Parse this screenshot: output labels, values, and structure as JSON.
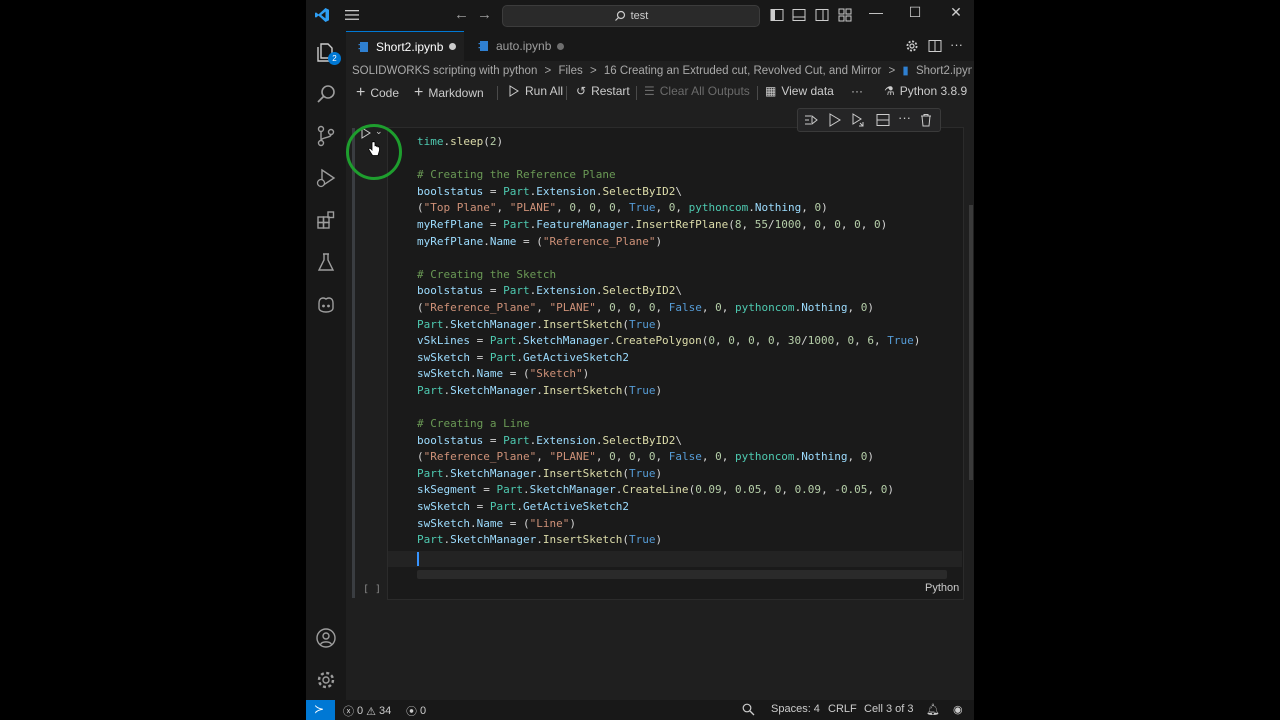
{
  "titlebar": {
    "search_text": "test"
  },
  "activity_badges": {
    "explorer": "2"
  },
  "tabs": [
    {
      "label": "Short2.ipynb",
      "active": true,
      "dirty": true
    },
    {
      "label": "auto.ipynb",
      "active": false,
      "dirty": true
    }
  ],
  "breadcrumb": {
    "part1": "SOLIDWORKS scripting with python",
    "sep1": ">",
    "part2": "Files",
    "sep2": ">",
    "part3": "16 Creating an Extruded cut, Revolved Cut, and Mirror",
    "sep3": ">",
    "part4": "Short2.ipynb",
    "sep4": ">"
  },
  "notebook_toolbar": {
    "code": "Code",
    "markdown": "Markdown",
    "run_all": "Run All",
    "restart": "Restart",
    "clear_all_outputs": "Clear All Outputs",
    "view_data": "View data",
    "more": "···",
    "kernel": "Python 3.8.9"
  },
  "cell": {
    "execution_count": "[ ]",
    "language": "Python",
    "code_lines": [
      "time.sleep(2)",
      "",
      "# Creating the Reference Plane",
      "boolstatus = Part.Extension.SelectByID2\\",
      "(\"Top Plane\", \"PLANE\", 0, 0, 0, True, 0, pythoncom.Nothing, 0)",
      "myRefPlane = Part.FeatureManager.InsertRefPlane(8, 55/1000, 0, 0, 0, 0)",
      "myRefPlane.Name = (\"Reference_Plane\")",
      "",
      "# Creating the Sketch",
      "boolstatus = Part.Extension.SelectByID2\\",
      "(\"Reference_Plane\", \"PLANE\", 0, 0, 0, False, 0, pythoncom.Nothing, 0)",
      "Part.SketchManager.InsertSketch(True)",
      "vSkLines = Part.SketchManager.CreatePolygon(0, 0, 0, 0, 30/1000, 0, 6, True)",
      "swSketch = Part.GetActiveSketch2",
      "swSketch.Name = (\"Sketch\")",
      "Part.SketchManager.InsertSketch(True)",
      "",
      "# Creating a Line",
      "boolstatus = Part.Extension.SelectByID2\\",
      "(\"Reference_Plane\", \"PLANE\", 0, 0, 0, False, 0, pythoncom.Nothing, 0)",
      "Part.SketchManager.InsertSketch(True)",
      "skSegment = Part.SketchManager.CreateLine(0.09, 0.05, 0, 0.09, -0.05, 0)",
      "swSketch = Part.GetActiveSketch2",
      "swSketch.Name = (\"Line\")",
      "Part.SketchManager.InsertSketch(True)"
    ]
  },
  "statusbar": {
    "errors": "0",
    "warnings": "34",
    "ports": "0",
    "spaces": "Spaces: 4",
    "eol": "CRLF",
    "cell_position": "Cell 3 of 3"
  },
  "colors": {
    "accent": "#0078d4",
    "highlight_circle": "#1e9e2e"
  }
}
